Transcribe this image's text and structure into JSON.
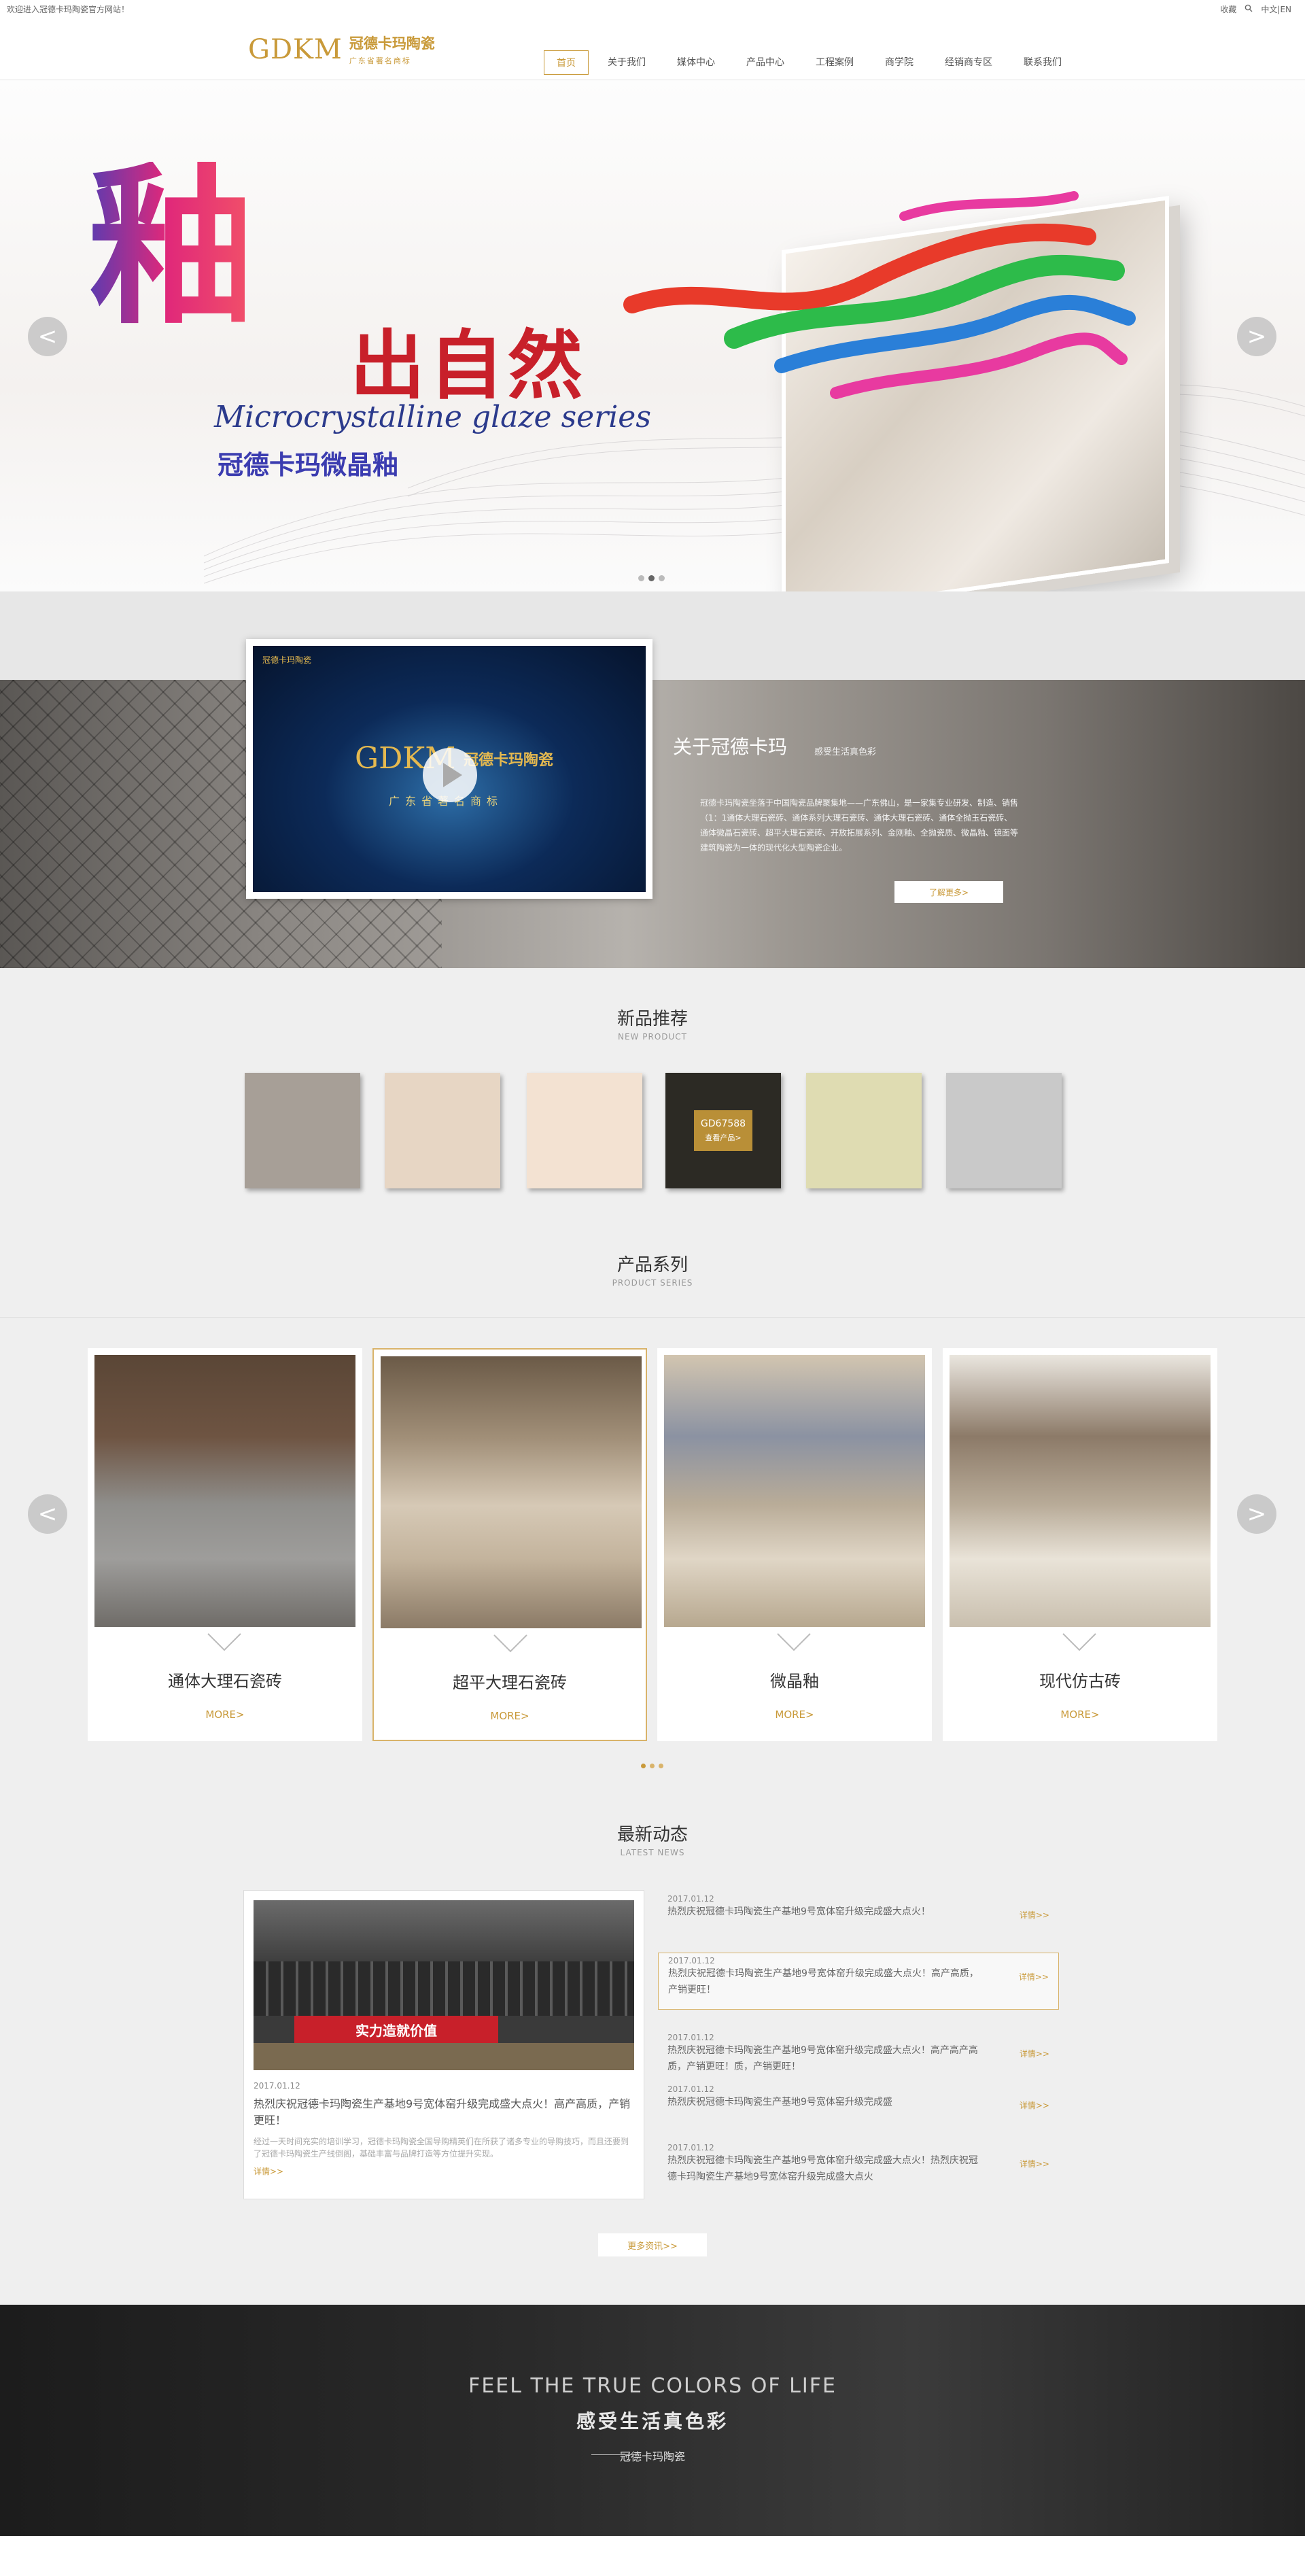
{
  "topbar": {
    "welcome": "欢迎进入冠德卡玛陶瓷官方网站！",
    "favorite": "收藏",
    "lang_cn": "中文",
    "lang_sep": "|",
    "lang_en": "EN"
  },
  "header": {
    "logo_mark": "GDKM",
    "logo_cn": "冠德卡玛陶瓷",
    "logo_sub": "广东省著名商标"
  },
  "nav": [
    "首页",
    "关于我们",
    "媒体中心",
    "产品中心",
    "工程案例",
    "商学院",
    "经销商专区",
    "联系我们"
  ],
  "banner": {
    "glyph": "釉",
    "headline": "出自然",
    "english": "Microcrystalline glaze series",
    "subtitle": "冠德卡玛微晶釉",
    "prev": "<",
    "next": ">"
  },
  "about": {
    "title": "关于冠德卡玛",
    "tag": "感受生活真色彩",
    "text": "冠德卡玛陶瓷坐落于中国陶瓷品牌聚集地——广东佛山，是一家集专业研发、制造、销售（1：1通体大理石瓷砖、通体系列大理石瓷砖、通体大理石瓷砖、通体全抛玉石瓷砖、通体微晶石瓷砖、超平大理石瓷砖、开放拓展系列、金刚釉、全抛瓷质、微晶釉、镜面等建筑陶瓷为一体的现代化大型陶瓷企业。",
    "button": "了解更多>",
    "video_mini": "冠德卡玛陶瓷",
    "video_logo": "GDKM",
    "video_cn": "冠德卡玛陶瓷",
    "video_sub": "广东省著名商标"
  },
  "new_products": {
    "title": "新品推荐",
    "en": "NEW PRODUCT",
    "highlight_code": "GD67588",
    "highlight_label": "查看产品>",
    "colors": [
      "#a79f97",
      "#e7d6c4",
      "#f3e2d2",
      "#2c2a24",
      "#dfdcb2",
      "#c9c9c9"
    ]
  },
  "series": {
    "title": "产品系列",
    "en": "PRODUCT SERIES",
    "prev": "<",
    "next": ">",
    "cards": [
      {
        "name": "通体大理石瓷砖",
        "more": "MORE>"
      },
      {
        "name": "超平大理石瓷砖",
        "more": "MORE>"
      },
      {
        "name": "微晶釉",
        "more": "MORE>"
      },
      {
        "name": "现代仿古砖",
        "more": "MORE>"
      }
    ]
  },
  "news": {
    "title": "最新动态",
    "en": "LATEST NEWS",
    "main": {
      "date": "2017.01.12",
      "title": "热烈庆祝冠德卡玛陶瓷生产基地9号宽体窑升级完成盛大点火！高产高质，产销更旺！",
      "desc": "经过一天时间充实的培训学习，冠德卡玛陶瓷全国导购精英们在所获了诸多专业的导购技巧，而且还要到了冠德卡玛陶瓷生产线倒阁，基础丰富与品牌打造等方位提升实现。",
      "more": "详情>>"
    },
    "items": [
      {
        "date": "2017.01.12",
        "title": "热烈庆祝冠德卡玛陶瓷生产基地9号宽体窑升级完成盛大点火！",
        "more": "详情>>"
      },
      {
        "date": "2017.01.12",
        "title": "热烈庆祝冠德卡玛陶瓷生产基地9号宽体窑升级完成盛大点火！高产高质，产销更旺！",
        "more": "详情>>"
      },
      {
        "date": "2017.01.12",
        "title": "热烈庆祝冠德卡玛陶瓷生产基地9号宽体窑升级完成盛大点火！高产高产高质，产销更旺！质，产销更旺！",
        "more": "详情>>"
      },
      {
        "date": "2017.01.12",
        "title": "热烈庆祝冠德卡玛陶瓷生产基地9号宽体窑升级完成盛",
        "more": "详情>>"
      },
      {
        "date": "2017.01.12",
        "title": "热烈庆祝冠德卡玛陶瓷生产基地9号宽体窑升级完成盛大点火！热烈庆祝冠德卡玛陶瓷生产基地9号宽体窑升级完成盛大点火",
        "more": "详情>>"
      }
    ],
    "more_button": "更多资讯>>",
    "banner_text": "实力造就价值"
  },
  "footer": {
    "en": "FEEL THE TRUE COLORS OF LIFE",
    "cn": "感受生活真色彩",
    "brand": "冠德卡玛陶瓷"
  },
  "colors": {
    "accent": "#c99a3a",
    "banner_red": "#c8202a",
    "footer_bg": "#2a2a2a"
  }
}
